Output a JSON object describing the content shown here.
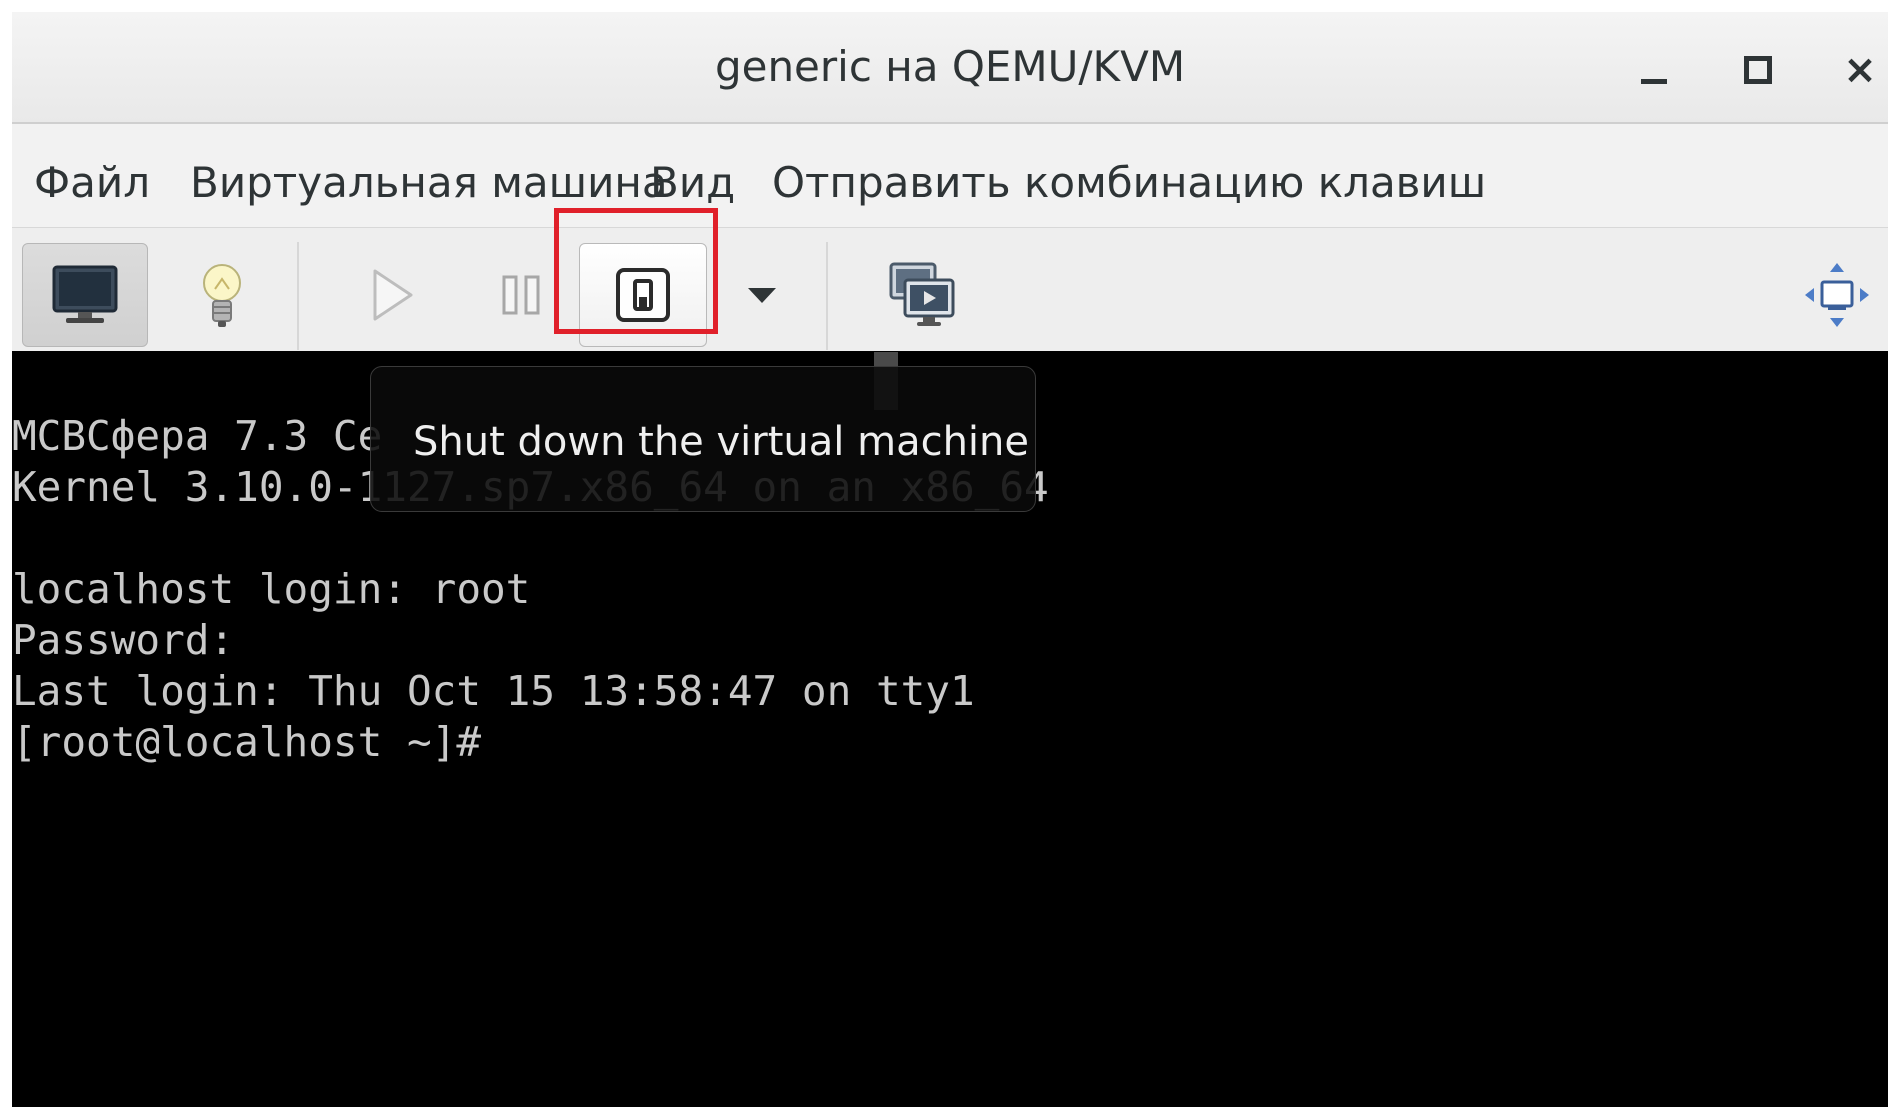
{
  "window": {
    "title": "generic  на QEMU/KVM",
    "controls": {
      "minimize": "minimize",
      "maximize": "maximize",
      "close": "×"
    }
  },
  "menubar": {
    "items": [
      "Файл",
      "Виртуальная машина",
      "Вид",
      "Отправить комбинацию клавиш"
    ]
  },
  "toolbar": {
    "buttons": [
      {
        "icon": "monitor-icon",
        "state": "pressed"
      },
      {
        "icon": "lightbulb-icon"
      },
      {
        "icon": "play-icon"
      },
      {
        "icon": "pause-icon"
      },
      {
        "icon": "power-switch-icon",
        "state": "highlighted"
      },
      {
        "icon": "chevron-down-icon"
      },
      {
        "icon": "screenshot-icon"
      },
      {
        "icon": "fullscreen-icon"
      }
    ]
  },
  "tooltip": {
    "text": "Shut down the virtual machine"
  },
  "console": {
    "lines": [
      "МСВСфера 7.3 Се",
      "Kernel 3.10.0-1127.sp7.x86_64 on an x86_64",
      "",
      "localhost login: root",
      "Password:",
      "Last login: Thu Oct 15 13:58:47 on tty1",
      "[root@localhost ~]#"
    ]
  },
  "colors": {
    "highlight": "#e0202a",
    "console_bg": "#000000",
    "console_fg": "#c9c9c9",
    "chrome_bg": "#f2f2f2"
  }
}
